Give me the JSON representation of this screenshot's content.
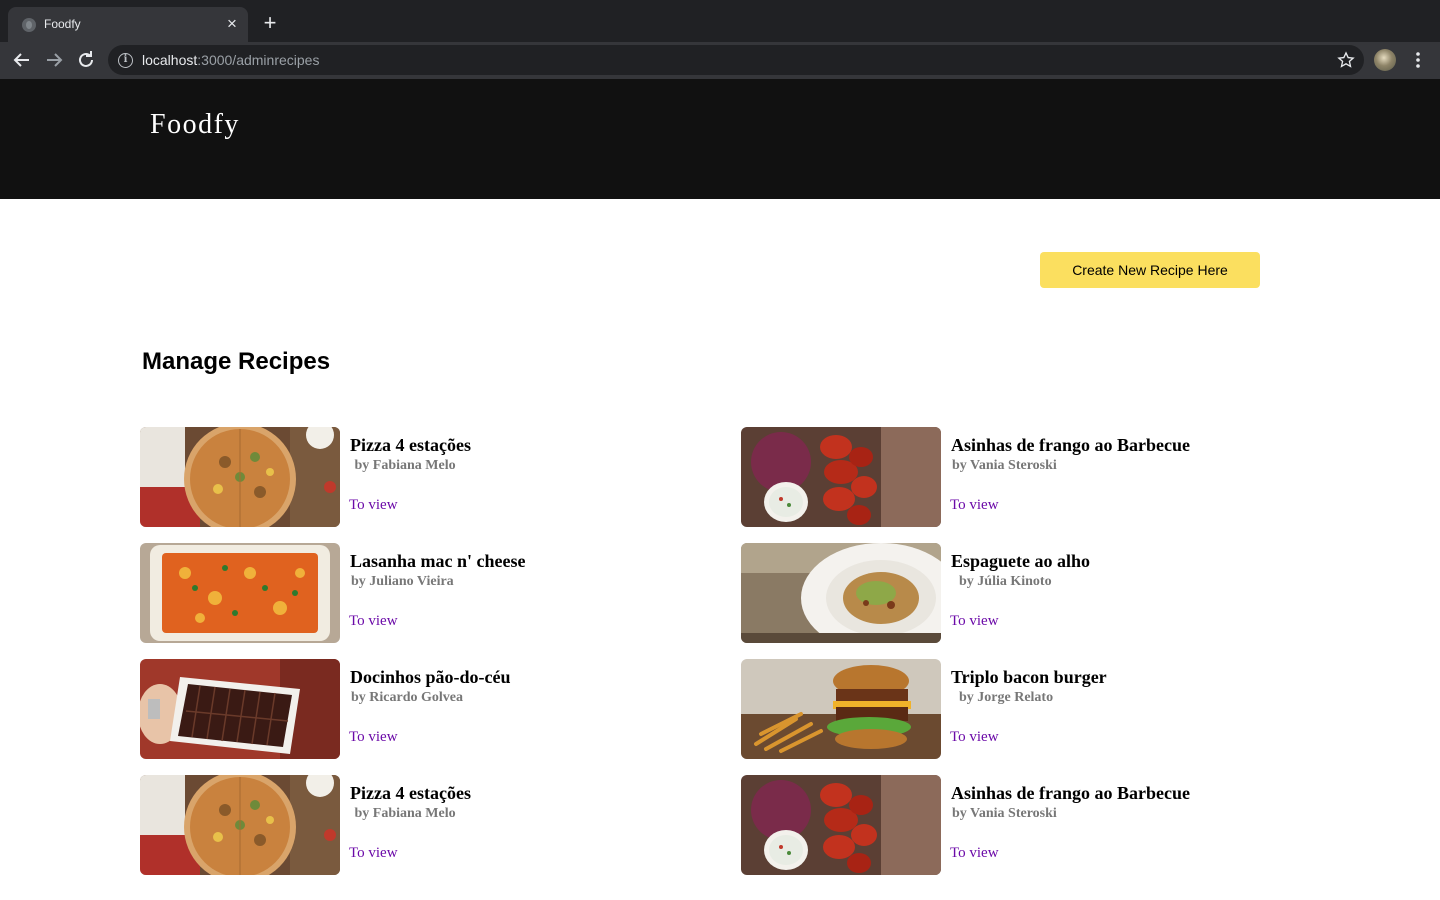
{
  "browser": {
    "tab_title": "Foodfy",
    "url_host": "localhost",
    "url_path": ":3000/adminrecipes"
  },
  "header": {
    "logo": "Foodfy"
  },
  "actions": {
    "create_label": "Create New Recipe Here"
  },
  "page": {
    "title": "Manage Recipes"
  },
  "recipes": [
    {
      "title": "Pizza 4 estações",
      "author": " by Fabiana Melo",
      "link": "To view",
      "image": "pizza"
    },
    {
      "title": "Asinhas de frango ao Barbecue",
      "author": "by Vania Steroski",
      "link": "To view",
      "image": "chicken-wings"
    },
    {
      "title": "Lasanha mac n' cheese",
      "author": "by Juliano Vieira",
      "link": "To view",
      "image": "lasagna"
    },
    {
      "title": "Espaguete ao alho",
      "author": "  by Júlia Kinoto",
      "link": "To view",
      "image": "spaghetti"
    },
    {
      "title": "Docinhos pão-do-céu",
      "author": "by Ricardo Golvea",
      "link": "To view",
      "image": "chocolates"
    },
    {
      "title": "Triplo bacon burger",
      "author": "  by Jorge Relato",
      "link": "To view",
      "image": "burger"
    },
    {
      "title": "Pizza 4 estações",
      "author": " by Fabiana Melo",
      "link": "To view",
      "image": "pizza"
    },
    {
      "title": "Asinhas de frango ao Barbecue",
      "author": "by Vania Steroski",
      "link": "To view",
      "image": "chicken-wings"
    }
  ],
  "colors": {
    "header_bg": "#111111",
    "button_bg": "#fbdf5f",
    "link": "#6b0aa8",
    "author": "#777777"
  }
}
